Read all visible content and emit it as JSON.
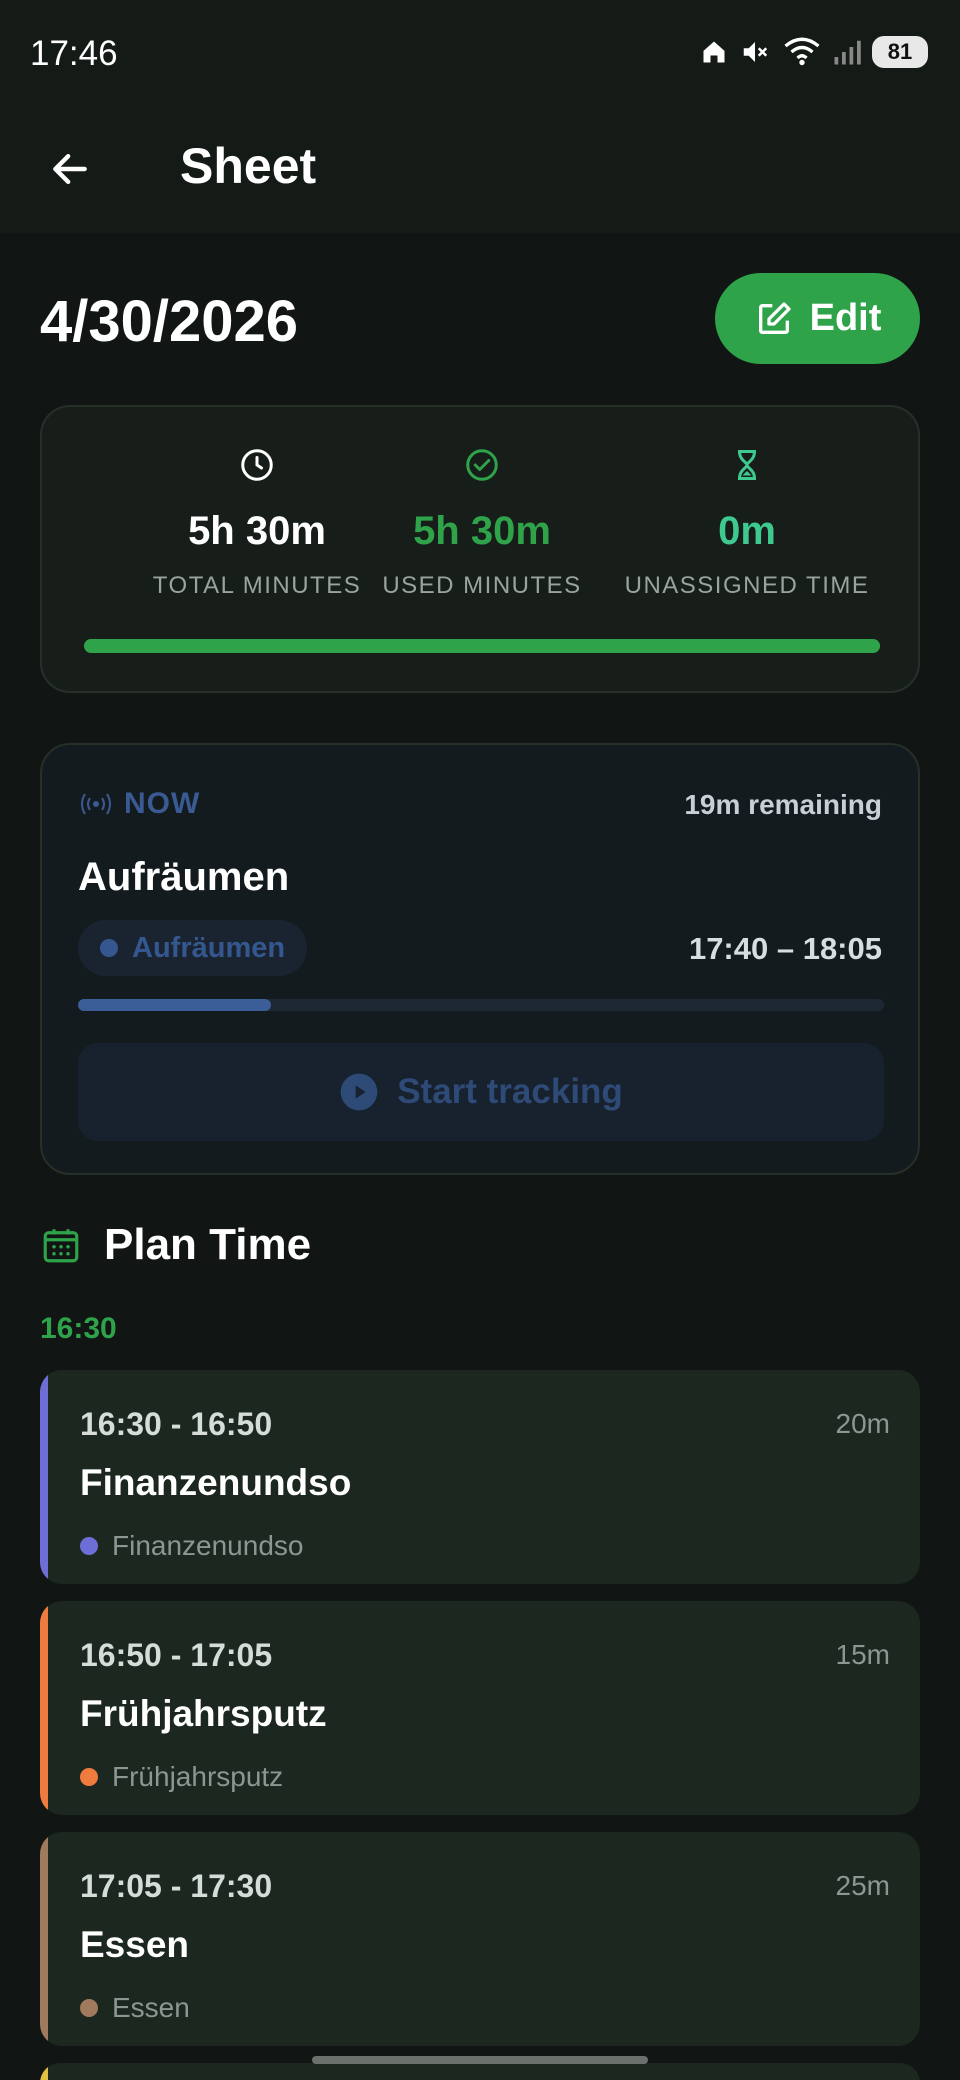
{
  "status_bar": {
    "time": "17:46",
    "battery": "81"
  },
  "app_bar": {
    "title": "Sheet"
  },
  "date": "4/30/2026",
  "edit_label": "Edit",
  "stats": [
    {
      "value": "5h 30m",
      "label": "TOTAL MINUTES",
      "icon": "clock-icon",
      "color": "#ffffff"
    },
    {
      "value": "5h 30m",
      "label": "USED MINUTES",
      "icon": "check-circle-icon",
      "color": "#2fa34a"
    },
    {
      "value": "0m",
      "label": "UNASSIGNED TIME",
      "icon": "hourglass-icon",
      "color": "#3ec98e"
    }
  ],
  "used_progress": 1.0,
  "now": {
    "label": "NOW",
    "remaining": "19m remaining",
    "title": "Aufräumen",
    "category": "Aufräumen",
    "time_range": "17:40 – 18:05",
    "progress": 0.24,
    "start_label": "Start tracking"
  },
  "plan": {
    "title": "Plan Time",
    "hour_label": "16:30",
    "entries": [
      {
        "time": "16:30 - 16:50",
        "duration": "20m",
        "name": "Finanzenundso",
        "category": "Finanzenundso",
        "color": "#6d6fd6"
      },
      {
        "time": "16:50 - 17:05",
        "duration": "15m",
        "name": "Frühjahrsputz",
        "category": "Frühjahrsputz",
        "color": "#f07b3f"
      },
      {
        "time": "17:05 - 17:30",
        "duration": "25m",
        "name": "Essen",
        "category": "Essen",
        "color": "#a07a5c"
      }
    ]
  },
  "colors": {
    "accent_green": "#2fa34a",
    "now_blue": "#35578f",
    "background": "#111513"
  }
}
